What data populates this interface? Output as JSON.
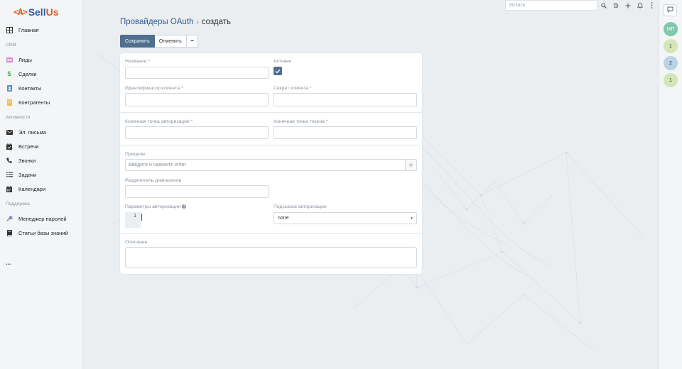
{
  "brand": {
    "logo_mark": "<A>",
    "name_part1": "Sell",
    "name_part2": "Us"
  },
  "sidebar": {
    "items": [
      {
        "label": "Главная",
        "icon": "grid-icon"
      },
      {
        "group": "CRM"
      },
      {
        "label": "Лиды",
        "icon": "id-card-icon"
      },
      {
        "label": "Сделки",
        "icon": "dollar-icon"
      },
      {
        "label": "Контакты",
        "icon": "contact-book-icon"
      },
      {
        "label": "Контрагенты",
        "icon": "building-icon"
      },
      {
        "group": "Активности"
      },
      {
        "label": "Эл. письма",
        "icon": "envelope-icon"
      },
      {
        "label": "Встречи",
        "icon": "calendar-check-icon"
      },
      {
        "label": "Звонки",
        "icon": "phone-icon"
      },
      {
        "label": "Задачи",
        "icon": "tasks-icon"
      },
      {
        "label": "Календари",
        "icon": "calendar-icon"
      },
      {
        "group": "Поддержка"
      },
      {
        "label": "Менеджер паролей",
        "icon": "key-icon"
      },
      {
        "label": "Статьи базы знаний",
        "icon": "book-icon"
      }
    ],
    "more": "..."
  },
  "topbar": {
    "search_placeholder": "Искать"
  },
  "breadcrumb": {
    "parent": "Провайдеры OAuth",
    "separator": "›",
    "current": "создать"
  },
  "actions": {
    "save": "Сохранить",
    "cancel": "Отменить",
    "more": "•••"
  },
  "form": {
    "name_label": "Название *",
    "active_label": "Активен",
    "active_checked": true,
    "client_id_label": "Идентификатор клиента *",
    "client_secret_label": "Секрет клиента *",
    "auth_endpoint_label": "Конечная точка авторизации *",
    "token_endpoint_label": "Конечная точка токена *",
    "scopes_label": "Прицелы",
    "scopes_placeholder": "Введите и нажмите enter",
    "scope_separator_label": "Разделитель диапазонов",
    "auth_params_label": "Параметры авторизации",
    "auth_params_line": "1",
    "auth_prompt_label": "Подсказка авторизации",
    "auth_prompt_value": "none",
    "description_label": "Описание"
  },
  "rightbar": {
    "avatar_initials": "МП",
    "badges": [
      "1",
      "2",
      "1"
    ]
  },
  "colors": {
    "accent": "#4e6f8e",
    "brand_blue": "#2f5f99",
    "brand_orange": "#e05a1e",
    "badge_green": "#d4e6b8",
    "badge_blue": "#b8d3e6",
    "avatar": "#7fc8a9"
  }
}
